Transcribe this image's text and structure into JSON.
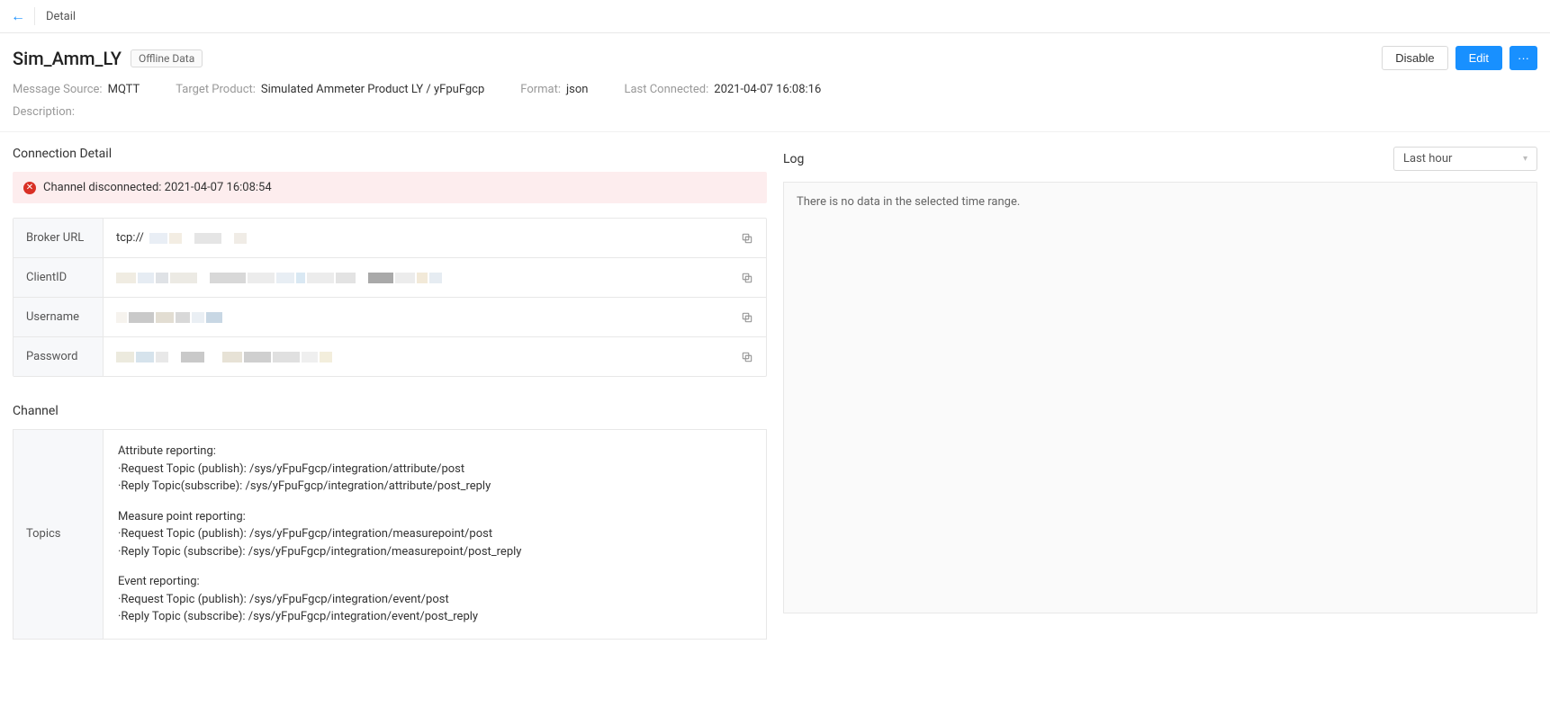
{
  "topbar": {
    "title": "Detail"
  },
  "header": {
    "title": "Sim_Amm_LY",
    "badge": "Offline Data",
    "actions": {
      "disable": "Disable",
      "edit": "Edit",
      "more": "···"
    },
    "meta": {
      "message_source_label": "Message Source:",
      "message_source_value": "MQTT",
      "target_product_label": "Target Product:",
      "target_product_value": "Simulated Ammeter Product LY / yFpuFgcp",
      "format_label": "Format:",
      "format_value": "json",
      "last_connected_label": "Last Connected:",
      "last_connected_value": "2021-04-07 16:08:16",
      "description_label": "Description:",
      "description_value": ""
    }
  },
  "connection": {
    "section_title": "Connection Detail",
    "alert": "Channel disconnected: 2021-04-07 16:08:54",
    "rows": {
      "broker_url_label": "Broker URL",
      "broker_url_prefix": "tcp://",
      "client_id_label": "ClientID",
      "username_label": "Username",
      "password_label": "Password"
    }
  },
  "channel": {
    "section_title": "Channel",
    "topics_label": "Topics",
    "groups": [
      {
        "title": "Attribute reporting:",
        "lines": [
          "·Request Topic (publish): /sys/yFpuFgcp/integration/attribute/post",
          "·Reply Topic(subscribe): /sys/yFpuFgcp/integration/attribute/post_reply"
        ]
      },
      {
        "title": "Measure point reporting:",
        "lines": [
          "·Request Topic (publish): /sys/yFpuFgcp/integration/measurepoint/post",
          "·Reply Topic (subscribe): /sys/yFpuFgcp/integration/measurepoint/post_reply"
        ]
      },
      {
        "title": "Event reporting:",
        "lines": [
          "·Request Topic (publish): /sys/yFpuFgcp/integration/event/post",
          "·Reply Topic (subscribe): /sys/yFpuFgcp/integration/event/post_reply"
        ]
      }
    ]
  },
  "log": {
    "title": "Log",
    "range": "Last hour",
    "empty": "There is no data in the selected time range."
  }
}
